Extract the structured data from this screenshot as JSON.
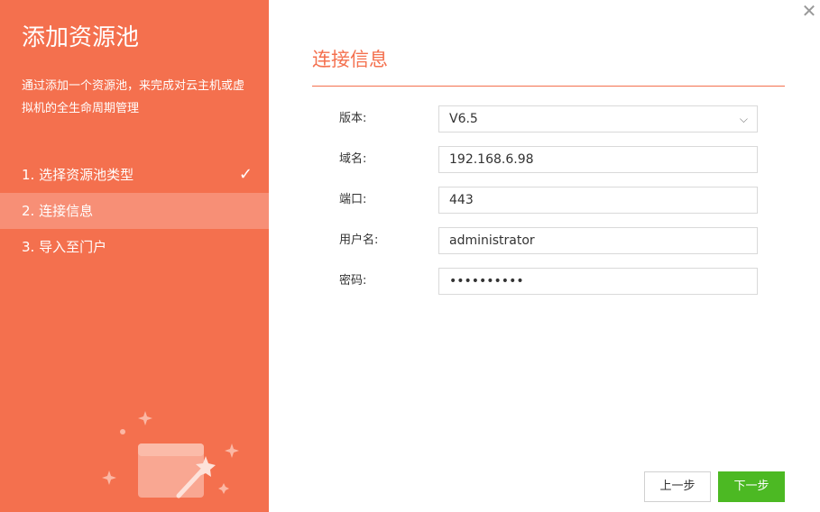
{
  "sidebar": {
    "title": "添加资源池",
    "description": "通过添加一个资源池，来完成对云主机或虚拟机的全生命周期管理",
    "steps": [
      {
        "label": "1. 选择资源池类型",
        "done": true
      },
      {
        "label": "2. 连接信息",
        "active": true
      },
      {
        "label": "3. 导入至门户"
      }
    ]
  },
  "form": {
    "section_title": "连接信息",
    "fields": {
      "version": {
        "label": "版本:",
        "value": "V6.5"
      },
      "domain": {
        "label": "域名:",
        "value": "192.168.6.98"
      },
      "port": {
        "label": "端口:",
        "value": "443"
      },
      "username": {
        "label": "用户名:",
        "value": "administrator"
      },
      "password": {
        "label": "密码:",
        "value": "••••••••••"
      }
    }
  },
  "footer": {
    "prev_label": "上一步",
    "next_label": "下一步"
  },
  "colors": {
    "accent": "#f4704e",
    "step_active_bg": "#f78f76",
    "next_button": "#4cb923"
  },
  "icons": {
    "check": "check-icon",
    "close": "close-icon",
    "dropdown": "chevron-down-icon",
    "illustration": "magic-wand-card-illustration"
  }
}
